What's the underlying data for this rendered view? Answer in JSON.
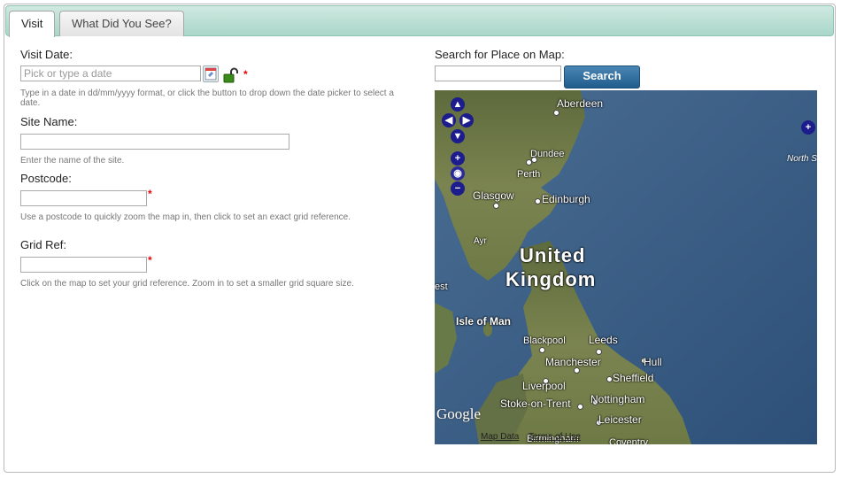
{
  "tabs": [
    {
      "label": "Visit",
      "active": true
    },
    {
      "label": "What Did You See?",
      "active": false
    }
  ],
  "form": {
    "visit_date": {
      "label": "Visit Date:",
      "placeholder": "Pick or type a date",
      "hint": "Type in a date in dd/mm/yyyy format, or click the button to drop down the date picker to select a date."
    },
    "site_name": {
      "label": "Site Name:",
      "value": "",
      "hint": "Enter the name of the site."
    },
    "postcode": {
      "label": "Postcode:",
      "value": "",
      "hint": "Use a postcode to quickly zoom the map in, then click to set an exact grid reference."
    },
    "grid_ref": {
      "label": "Grid Ref:",
      "value": "",
      "hint": "Click on the map to set your grid reference. Zoom in to set a smaller grid square size."
    },
    "required_marker": "*"
  },
  "map_search": {
    "label": "Search for Place on Map:",
    "value": "",
    "button_label": "Search"
  },
  "map": {
    "places": {
      "aberdeen": "Aberdeen",
      "dundee": "Dundee",
      "perth": "Perth",
      "glasgow": "Glasgow",
      "edinburgh": "Edinburgh",
      "ayr": "Ayr",
      "country_line1": "United",
      "country_line2": "Kingdom",
      "isle_of_man": "Isle of Man",
      "blackpool": "Blackpool",
      "leeds": "Leeds",
      "manchester": "Manchester",
      "hull": "Hull",
      "sheffield": "Sheffield",
      "liverpool": "Liverpool",
      "nottingham": "Nottingham",
      "stoke": "Stoke-on-Trent",
      "leicester": "Leicester",
      "birmingham": "Birmingham",
      "coventry": "Coventry",
      "east_fragment": "est"
    },
    "sea_label": "North S",
    "logo": "Google",
    "map_data_link": "Map Data",
    "terms_link": "Terms of Use",
    "colors": {
      "sea": "#3a5f86",
      "land": "#6f7a45",
      "nav": "#1c1c8c"
    }
  }
}
